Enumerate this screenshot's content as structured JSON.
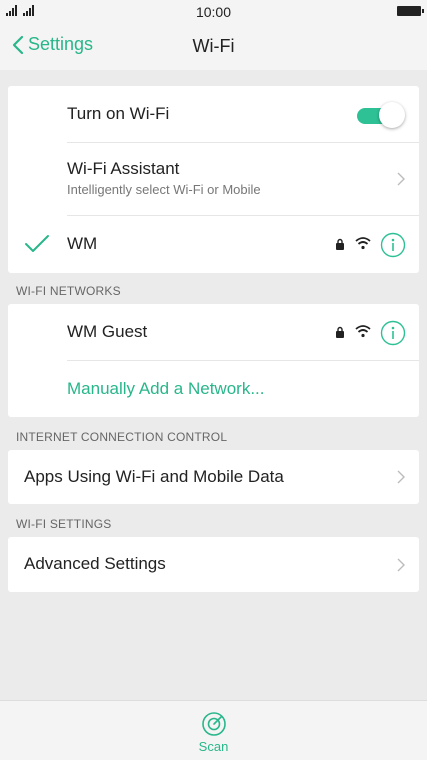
{
  "status_bar": {
    "time": "10:00"
  },
  "navbar": {
    "back_label": "Settings",
    "title": "Wi-Fi"
  },
  "wifi_toggle": {
    "label": "Turn on Wi-Fi",
    "on": true
  },
  "assistant": {
    "label": "Wi-Fi Assistant",
    "sublabel": "Intelligently select Wi-Fi or Mobile"
  },
  "connected_network": {
    "ssid": "WM",
    "secured": true
  },
  "sections": {
    "networks_header": "WI-FI NETWORKS",
    "connection_header": "INTERNET CONNECTION CONTROL",
    "settings_header": "WI-FI SETTINGS"
  },
  "networks": [
    {
      "ssid": "WM Guest",
      "secured": true
    }
  ],
  "manual_add_label": "Manually Add a Network...",
  "apps_using_label": "Apps Using Wi-Fi and Mobile Data",
  "advanced_label": "Advanced Settings",
  "bottom": {
    "scan_label": "Scan"
  },
  "colors": {
    "accent": "#28b68a",
    "toggle": "#2ec196",
    "background": "#ebebeb"
  }
}
